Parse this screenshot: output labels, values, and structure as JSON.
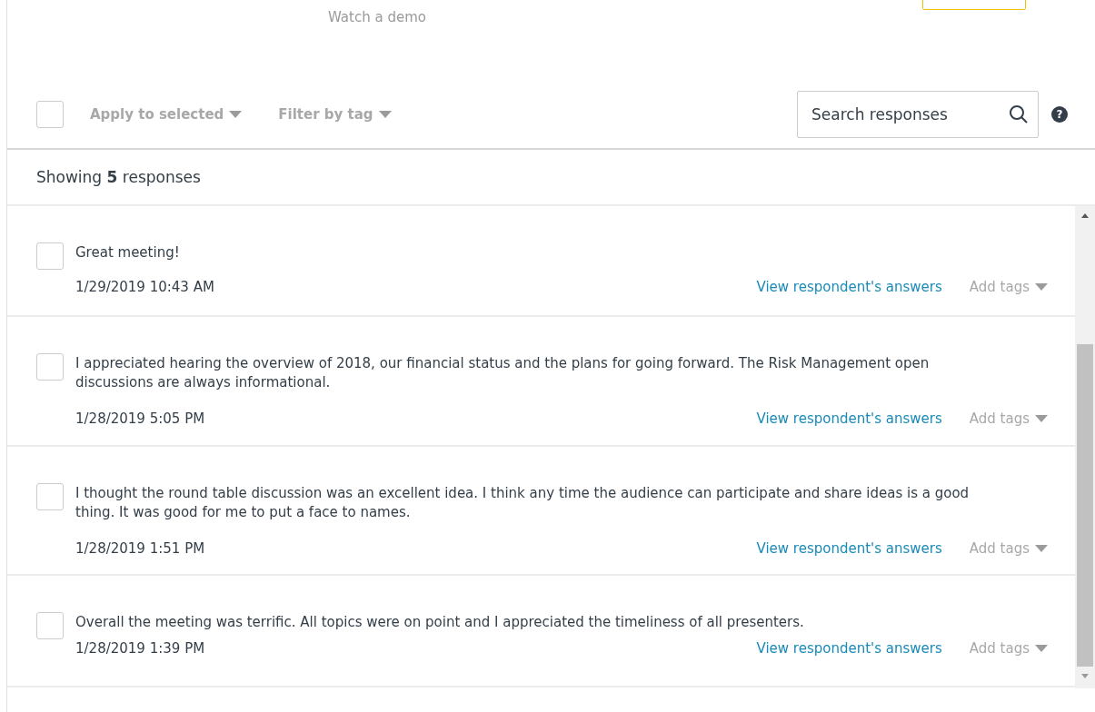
{
  "header": {
    "demo_link": "Watch a demo"
  },
  "toolbar": {
    "select_all": {
      "checked": false
    },
    "apply_menu": "Apply to selected",
    "filter_menu": "Filter by tag",
    "search": {
      "placeholder": "Search responses"
    },
    "help": "?"
  },
  "summary": "Showing **5** responses",
  "responses": [
    {
      "text": "Great meeting!",
      "date": "1/29/2019 10:43 AM",
      "link": "View respondent's answers",
      "tags": "Add tags",
      "checked": false
    },
    {
      "text": "I appreciated hearing the overview of 2018, our financial status and the plans for going forward. The Risk Management open discussions are always informational.",
      "date": "1/28/2019 5:05 PM",
      "link": "View respondent's answers",
      "tags": "Add tags",
      "checked": false
    },
    {
      "text": "I thought the round table discussion was an excellent idea. I think any time the audience can participate and share ideas is a good thing. It was good for me to put a face to names.",
      "date": "1/28/2019 1:51 PM",
      "link": "View respondent's answers",
      "tags": "Add tags",
      "checked": false
    },
    {
      "text": "Overall the meeting was terrific. All topics were on point and I appreciated the timeliness of all presenters.",
      "date": "1/28/2019 1:39 PM",
      "link": "View respondent's answers",
      "tags": "Add tags",
      "checked": false
    }
  ]
}
